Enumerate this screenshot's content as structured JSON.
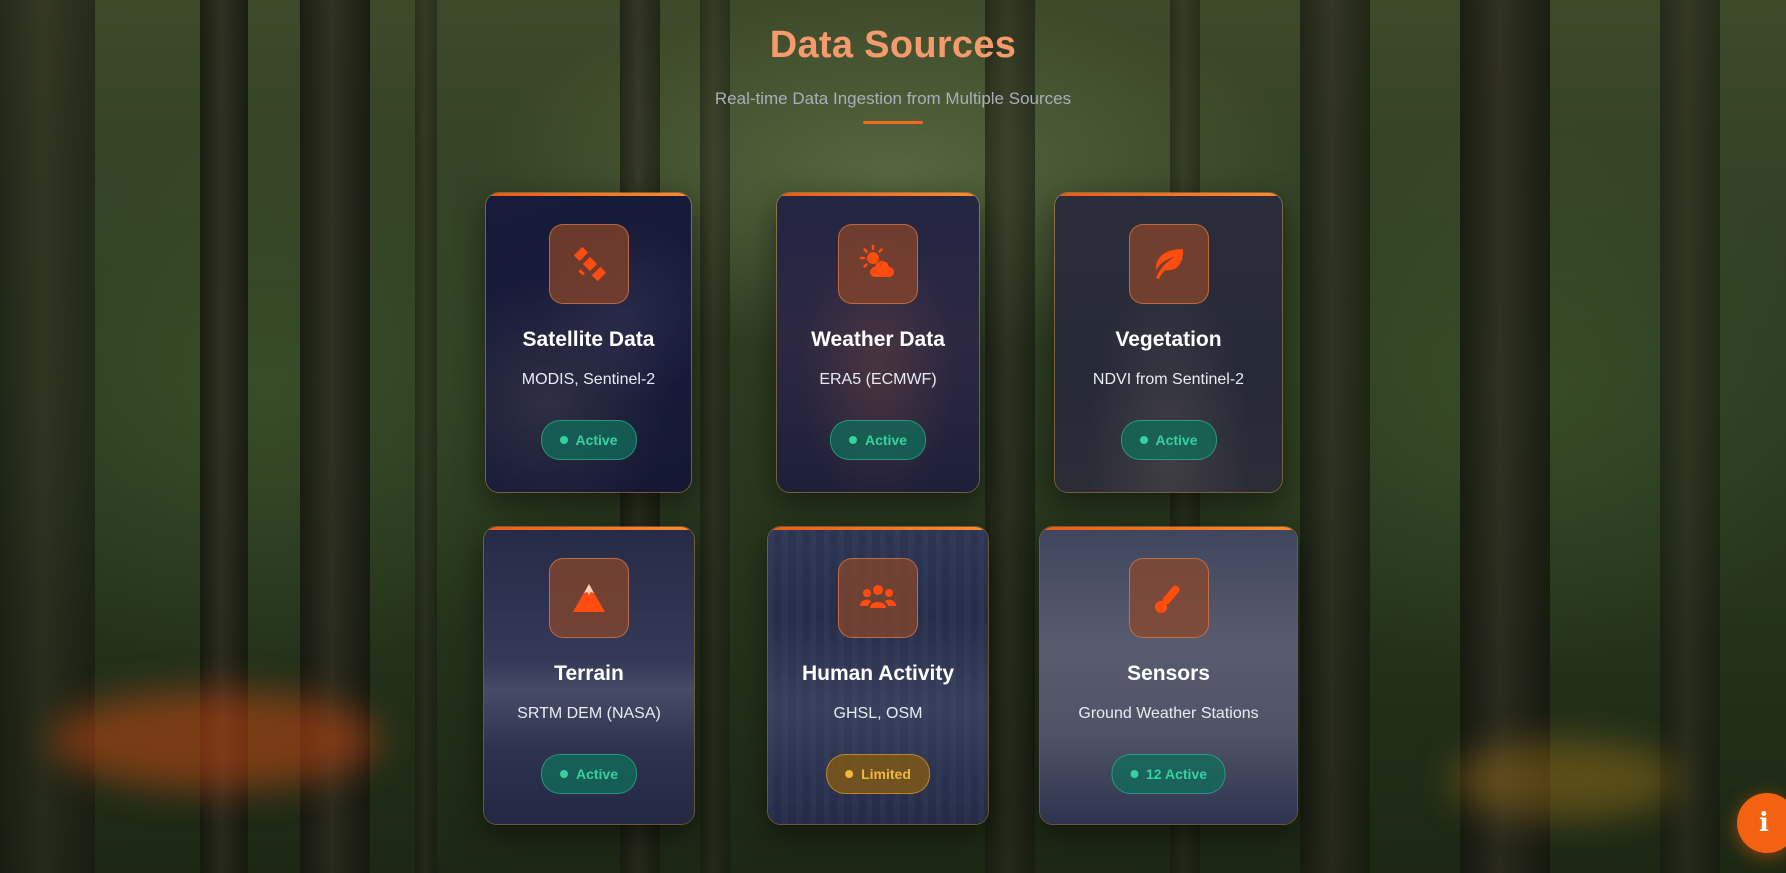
{
  "header": {
    "title": "Data Sources",
    "subtitle": "Real-time Data Ingestion from Multiple Sources"
  },
  "colors": {
    "accent": "#f26a1e",
    "title": "#f59a6c",
    "active": "#35d2a0",
    "limited": "#f4b63b"
  },
  "cards": [
    {
      "title": "Satellite Data",
      "subtitle": "MODIS, Sentinel-2",
      "status": "Active",
      "status_type": "active",
      "icon": "satellite-icon"
    },
    {
      "title": "Weather Data",
      "subtitle": "ERA5 (ECMWF)",
      "status": "Active",
      "status_type": "active",
      "icon": "cloud-sun-icon"
    },
    {
      "title": "Vegetation",
      "subtitle": "NDVI from Sentinel-2",
      "status": "Active",
      "status_type": "active",
      "icon": "leaf-icon"
    },
    {
      "title": "Terrain",
      "subtitle": "SRTM DEM (NASA)",
      "status": "Active",
      "status_type": "active",
      "icon": "mountain-icon"
    },
    {
      "title": "Human Activity",
      "subtitle": "GHSL, OSM",
      "status": "Limited",
      "status_type": "limited",
      "icon": "users-icon"
    },
    {
      "title": "Sensors",
      "subtitle": "Ground Weather Stations",
      "status": "12 Active",
      "status_type": "active",
      "icon": "thermometer-icon"
    }
  ],
  "info_button": {
    "label": "i",
    "icon": "info-icon"
  }
}
